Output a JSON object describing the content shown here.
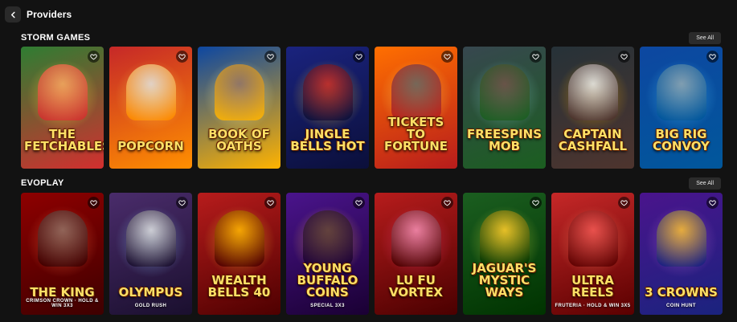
{
  "page": {
    "title": "Providers"
  },
  "sections": [
    {
      "title": "STORM GAMES",
      "see_all": "See All",
      "games": [
        {
          "title": "The Fetchables",
          "sub": "",
          "c1": "#2e7d32",
          "c2": "#d32f2f",
          "glow": "#ffeb3b",
          "char": "#f4a261",
          "icon": "heart-icon"
        },
        {
          "title": "Popcorn",
          "sub": "",
          "c1": "#c62828",
          "c2": "#ff8f00",
          "glow": "#ffd54f",
          "char": "#e0e0e0",
          "icon": "heart-icon"
        },
        {
          "title": "Book of Oaths",
          "sub": "",
          "c1": "#0d47a1",
          "c2": "#ffb300",
          "glow": "#fff59d",
          "char": "#8d6e63",
          "icon": "heart-icon"
        },
        {
          "title": "Jingle Bells Hot",
          "sub": "",
          "c1": "#1a237e",
          "c2": "#0b0f3a",
          "glow": "#ffca28",
          "char": "#c62828",
          "icon": "heart-icon"
        },
        {
          "title": "Tickets to Fortune",
          "sub": "",
          "c1": "#ff6f00",
          "c2": "#b71c1c",
          "glow": "#ffee58",
          "char": "#616161",
          "icon": "heart-icon"
        },
        {
          "title": "Freespins Mob",
          "sub": "",
          "c1": "#37474f",
          "c2": "#1b5e20",
          "glow": "#80cbc4",
          "char": "#6d4c41",
          "icon": "heart-icon"
        },
        {
          "title": "Captain Cashfall",
          "sub": "",
          "c1": "#263238",
          "c2": "#4e342e",
          "glow": "#ffb300",
          "char": "#eceff1",
          "icon": "heart-icon"
        },
        {
          "title": "Big Rig Convoy",
          "sub": "",
          "c1": "#0d47a1",
          "c2": "#01579b",
          "glow": "#4fc3f7",
          "char": "#90a4ae",
          "icon": "heart-icon"
        }
      ]
    },
    {
      "title": "EVOPLAY",
      "see_all": "See All",
      "games": [
        {
          "title": "The King",
          "sub": "Crimson Crown · Hold & Win 3x3",
          "c1": "#8e0000",
          "c2": "#3e0000",
          "glow": "#ff7043",
          "char": "#8d6e63",
          "icon": "heart-icon"
        },
        {
          "title": "Olympus",
          "sub": "Gold Rush",
          "c1": "#4a2c6b",
          "c2": "#1a0f2e",
          "glow": "#90caf9",
          "char": "#e0e0e0",
          "icon": "heart-icon"
        },
        {
          "title": "Wealth Bells 40",
          "sub": "",
          "c1": "#b71c1c",
          "c2": "#4e0000",
          "glow": "#ffca28",
          "char": "#ffb300",
          "icon": "heart-icon"
        },
        {
          "title": "Young Buffalo Coins",
          "sub": "Special 3x3",
          "c1": "#4a148c",
          "c2": "#1a0033",
          "glow": "#ffb74d",
          "char": "#5d4037",
          "icon": "heart-icon"
        },
        {
          "title": "Lu Fu Vortex",
          "sub": "",
          "c1": "#b71c1c",
          "c2": "#4a0000",
          "glow": "#ec407a",
          "char": "#f48fb1",
          "icon": "heart-icon"
        },
        {
          "title": "Jaguar's Mystic Ways",
          "sub": "",
          "c1": "#1b5e20",
          "c2": "#003300",
          "glow": "#cddc39",
          "char": "#ffca28",
          "icon": "heart-icon"
        },
        {
          "title": "Ultra Reels",
          "sub": "Fruteria · Hold & Win 3x5",
          "c1": "#c62828",
          "c2": "#5a0000",
          "glow": "#ff8a65",
          "char": "#ef5350",
          "icon": "heart-icon"
        },
        {
          "title": "3 Crowns",
          "sub": "Coin Hunt",
          "c1": "#4a148c",
          "c2": "#1a237e",
          "glow": "#ba68c8",
          "char": "#fbc02d",
          "icon": "heart-icon"
        }
      ]
    }
  ]
}
